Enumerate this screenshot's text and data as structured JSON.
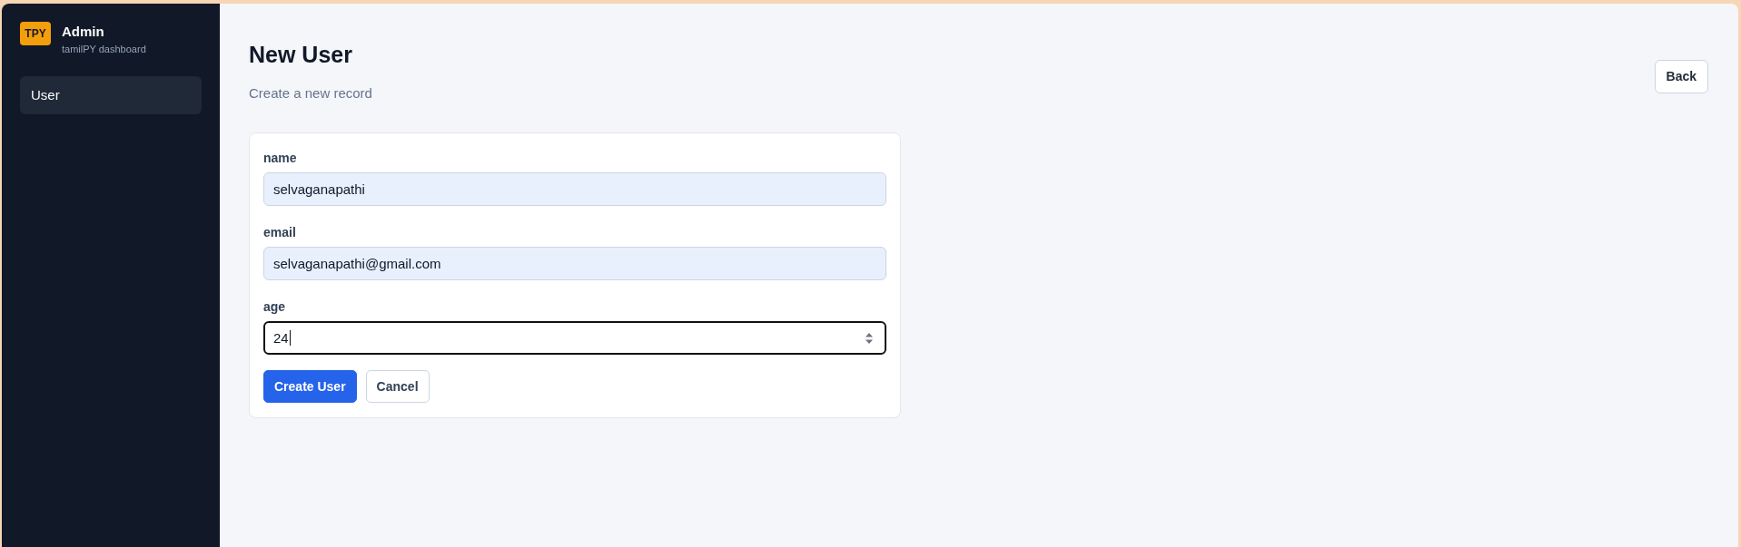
{
  "sidebar": {
    "brand": {
      "badge": "TPY",
      "title": "Admin",
      "subtitle": "tamilPY dashboard"
    },
    "items": [
      {
        "label": "User",
        "selected": true
      }
    ]
  },
  "header": {
    "title": "New User",
    "subtitle": "Create a new record",
    "back_button": "Back"
  },
  "form": {
    "fields": [
      {
        "label": "name",
        "value": "selvaganapathi",
        "kind": "text",
        "autofilled": true,
        "focused": false
      },
      {
        "label": "email",
        "value": "selvaganapathi@gmail.com",
        "kind": "text",
        "autofilled": true,
        "focused": false
      },
      {
        "label": "age",
        "value": "24",
        "kind": "number",
        "autofilled": false,
        "focused": true
      }
    ],
    "buttons": [
      {
        "label": "Create User",
        "kind": "primary"
      },
      {
        "label": "Cancel",
        "kind": "secondary"
      }
    ]
  }
}
